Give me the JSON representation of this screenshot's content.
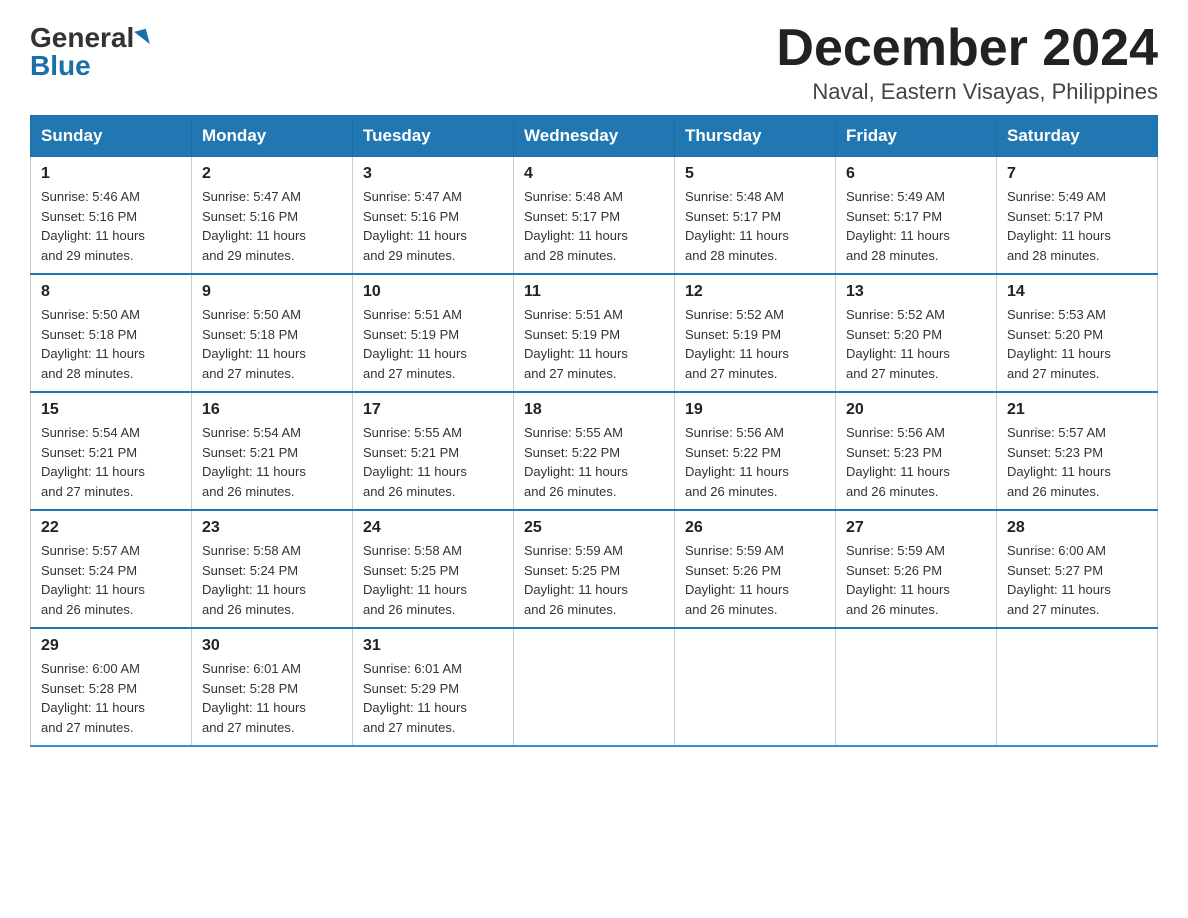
{
  "header": {
    "logo_general": "General",
    "logo_blue": "Blue",
    "month_title": "December 2024",
    "location": "Naval, Eastern Visayas, Philippines"
  },
  "days_of_week": [
    "Sunday",
    "Monday",
    "Tuesday",
    "Wednesday",
    "Thursday",
    "Friday",
    "Saturday"
  ],
  "weeks": [
    [
      {
        "day": "1",
        "sunrise": "5:46 AM",
        "sunset": "5:16 PM",
        "daylight": "11 hours and 29 minutes."
      },
      {
        "day": "2",
        "sunrise": "5:47 AM",
        "sunset": "5:16 PM",
        "daylight": "11 hours and 29 minutes."
      },
      {
        "day": "3",
        "sunrise": "5:47 AM",
        "sunset": "5:16 PM",
        "daylight": "11 hours and 29 minutes."
      },
      {
        "day": "4",
        "sunrise": "5:48 AM",
        "sunset": "5:17 PM",
        "daylight": "11 hours and 28 minutes."
      },
      {
        "day": "5",
        "sunrise": "5:48 AM",
        "sunset": "5:17 PM",
        "daylight": "11 hours and 28 minutes."
      },
      {
        "day": "6",
        "sunrise": "5:49 AM",
        "sunset": "5:17 PM",
        "daylight": "11 hours and 28 minutes."
      },
      {
        "day": "7",
        "sunrise": "5:49 AM",
        "sunset": "5:17 PM",
        "daylight": "11 hours and 28 minutes."
      }
    ],
    [
      {
        "day": "8",
        "sunrise": "5:50 AM",
        "sunset": "5:18 PM",
        "daylight": "11 hours and 28 minutes."
      },
      {
        "day": "9",
        "sunrise": "5:50 AM",
        "sunset": "5:18 PM",
        "daylight": "11 hours and 27 minutes."
      },
      {
        "day": "10",
        "sunrise": "5:51 AM",
        "sunset": "5:19 PM",
        "daylight": "11 hours and 27 minutes."
      },
      {
        "day": "11",
        "sunrise": "5:51 AM",
        "sunset": "5:19 PM",
        "daylight": "11 hours and 27 minutes."
      },
      {
        "day": "12",
        "sunrise": "5:52 AM",
        "sunset": "5:19 PM",
        "daylight": "11 hours and 27 minutes."
      },
      {
        "day": "13",
        "sunrise": "5:52 AM",
        "sunset": "5:20 PM",
        "daylight": "11 hours and 27 minutes."
      },
      {
        "day": "14",
        "sunrise": "5:53 AM",
        "sunset": "5:20 PM",
        "daylight": "11 hours and 27 minutes."
      }
    ],
    [
      {
        "day": "15",
        "sunrise": "5:54 AM",
        "sunset": "5:21 PM",
        "daylight": "11 hours and 27 minutes."
      },
      {
        "day": "16",
        "sunrise": "5:54 AM",
        "sunset": "5:21 PM",
        "daylight": "11 hours and 26 minutes."
      },
      {
        "day": "17",
        "sunrise": "5:55 AM",
        "sunset": "5:21 PM",
        "daylight": "11 hours and 26 minutes."
      },
      {
        "day": "18",
        "sunrise": "5:55 AM",
        "sunset": "5:22 PM",
        "daylight": "11 hours and 26 minutes."
      },
      {
        "day": "19",
        "sunrise": "5:56 AM",
        "sunset": "5:22 PM",
        "daylight": "11 hours and 26 minutes."
      },
      {
        "day": "20",
        "sunrise": "5:56 AM",
        "sunset": "5:23 PM",
        "daylight": "11 hours and 26 minutes."
      },
      {
        "day": "21",
        "sunrise": "5:57 AM",
        "sunset": "5:23 PM",
        "daylight": "11 hours and 26 minutes."
      }
    ],
    [
      {
        "day": "22",
        "sunrise": "5:57 AM",
        "sunset": "5:24 PM",
        "daylight": "11 hours and 26 minutes."
      },
      {
        "day": "23",
        "sunrise": "5:58 AM",
        "sunset": "5:24 PM",
        "daylight": "11 hours and 26 minutes."
      },
      {
        "day": "24",
        "sunrise": "5:58 AM",
        "sunset": "5:25 PM",
        "daylight": "11 hours and 26 minutes."
      },
      {
        "day": "25",
        "sunrise": "5:59 AM",
        "sunset": "5:25 PM",
        "daylight": "11 hours and 26 minutes."
      },
      {
        "day": "26",
        "sunrise": "5:59 AM",
        "sunset": "5:26 PM",
        "daylight": "11 hours and 26 minutes."
      },
      {
        "day": "27",
        "sunrise": "5:59 AM",
        "sunset": "5:26 PM",
        "daylight": "11 hours and 26 minutes."
      },
      {
        "day": "28",
        "sunrise": "6:00 AM",
        "sunset": "5:27 PM",
        "daylight": "11 hours and 27 minutes."
      }
    ],
    [
      {
        "day": "29",
        "sunrise": "6:00 AM",
        "sunset": "5:28 PM",
        "daylight": "11 hours and 27 minutes."
      },
      {
        "day": "30",
        "sunrise": "6:01 AM",
        "sunset": "5:28 PM",
        "daylight": "11 hours and 27 minutes."
      },
      {
        "day": "31",
        "sunrise": "6:01 AM",
        "sunset": "5:29 PM",
        "daylight": "11 hours and 27 minutes."
      },
      null,
      null,
      null,
      null
    ]
  ],
  "labels": {
    "sunrise": "Sunrise:",
    "sunset": "Sunset:",
    "daylight": "Daylight:"
  }
}
